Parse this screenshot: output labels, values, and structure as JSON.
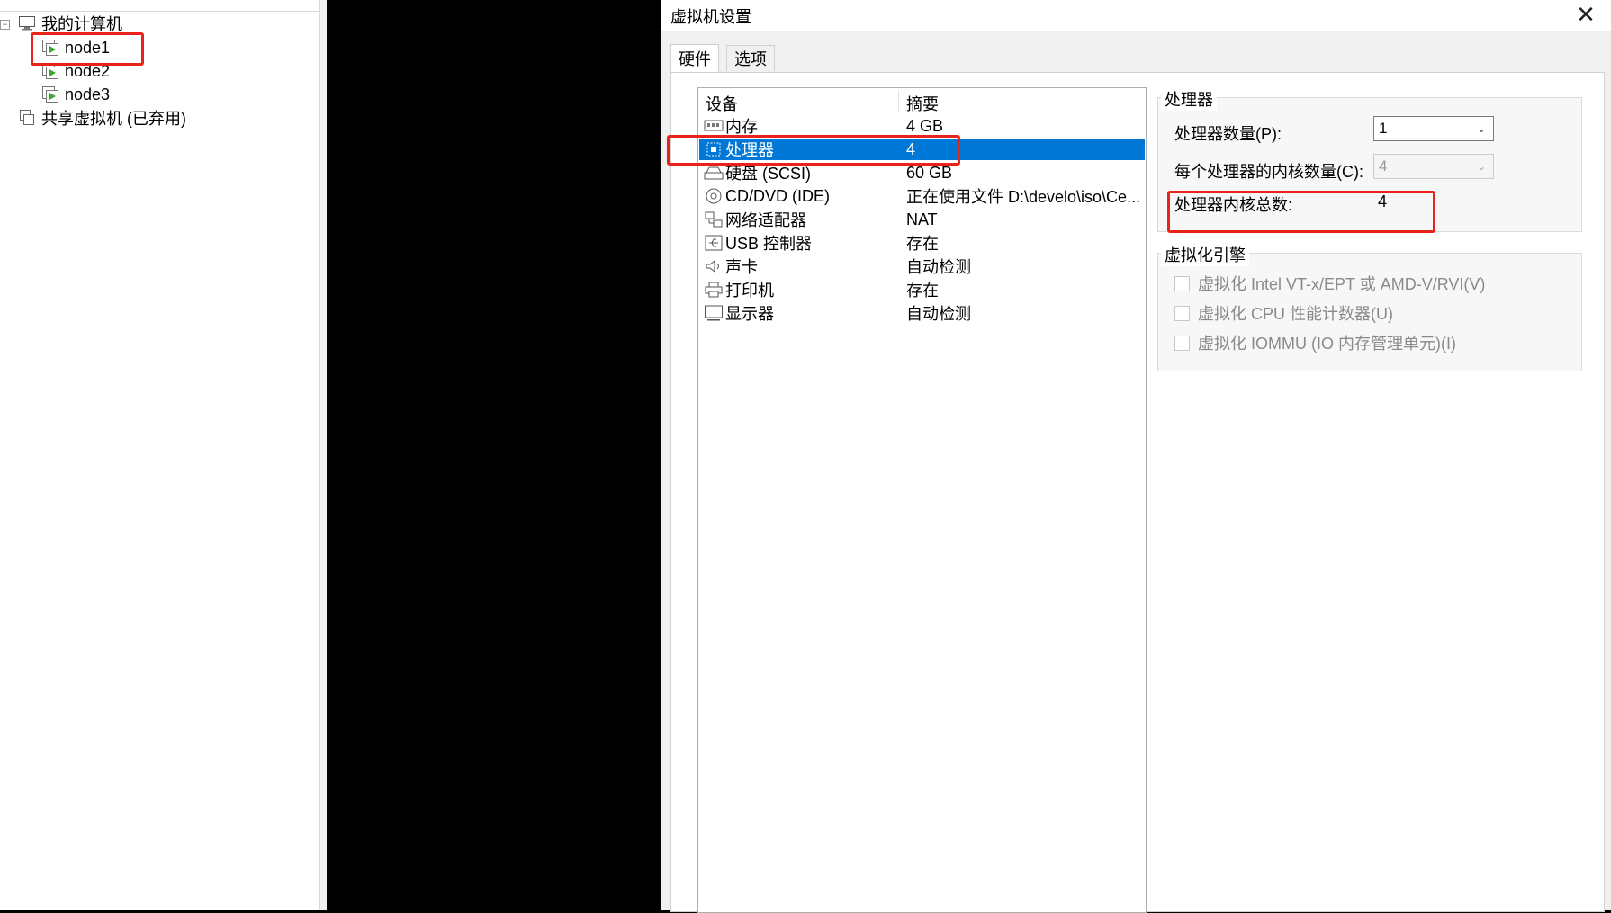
{
  "library": {
    "root_label": "我的计算机",
    "vms": [
      "node1",
      "node2",
      "node3"
    ],
    "shared_label": "共享虚拟机 (已弃用)",
    "collapse_glyph": "−"
  },
  "dialog": {
    "title": "虚拟机设置",
    "close_glyph": "✕",
    "tabs": [
      "硬件",
      "选项"
    ],
    "device_list": {
      "headers": {
        "device": "设备",
        "summary": "摘要"
      },
      "devices": [
        {
          "icon": "memory-icon",
          "name": "内存",
          "summary": "4 GB"
        },
        {
          "icon": "cpu-icon",
          "name": "处理器",
          "summary": "4"
        },
        {
          "icon": "harddisk-icon",
          "name": "硬盘 (SCSI)",
          "summary": "60 GB"
        },
        {
          "icon": "cdrom-icon",
          "name": "CD/DVD (IDE)",
          "summary": "正在使用文件 D:\\develo\\iso\\Ce..."
        },
        {
          "icon": "network-icon",
          "name": "网络适配器",
          "summary": "NAT"
        },
        {
          "icon": "usb-icon",
          "name": "USB 控制器",
          "summary": "存在"
        },
        {
          "icon": "sound-icon",
          "name": "声卡",
          "summary": "自动检测"
        },
        {
          "icon": "printer-icon",
          "name": "打印机",
          "summary": "存在"
        },
        {
          "icon": "display-icon",
          "name": "显示器",
          "summary": "自动检测"
        }
      ],
      "selected_index": 1
    },
    "processor": {
      "group_title": "处理器",
      "count_label": "处理器数量(P):",
      "count_value": "1",
      "cores_label": "每个处理器的内核数量(C):",
      "cores_value": "4",
      "total_label": "处理器内核总数:",
      "total_value": "4"
    },
    "virtualization": {
      "group_title": "虚拟化引擎",
      "options": [
        "虚拟化 Intel VT-x/EPT 或 AMD-V/RVI(V)",
        "虚拟化 CPU 性能计数器(U)",
        "虚拟化 IOMMU (IO 内存管理单元)(I)"
      ]
    }
  },
  "colors": {
    "selection": "#0078d7",
    "highlight_box": "#e8231a",
    "vm_play": "#3aa832"
  }
}
